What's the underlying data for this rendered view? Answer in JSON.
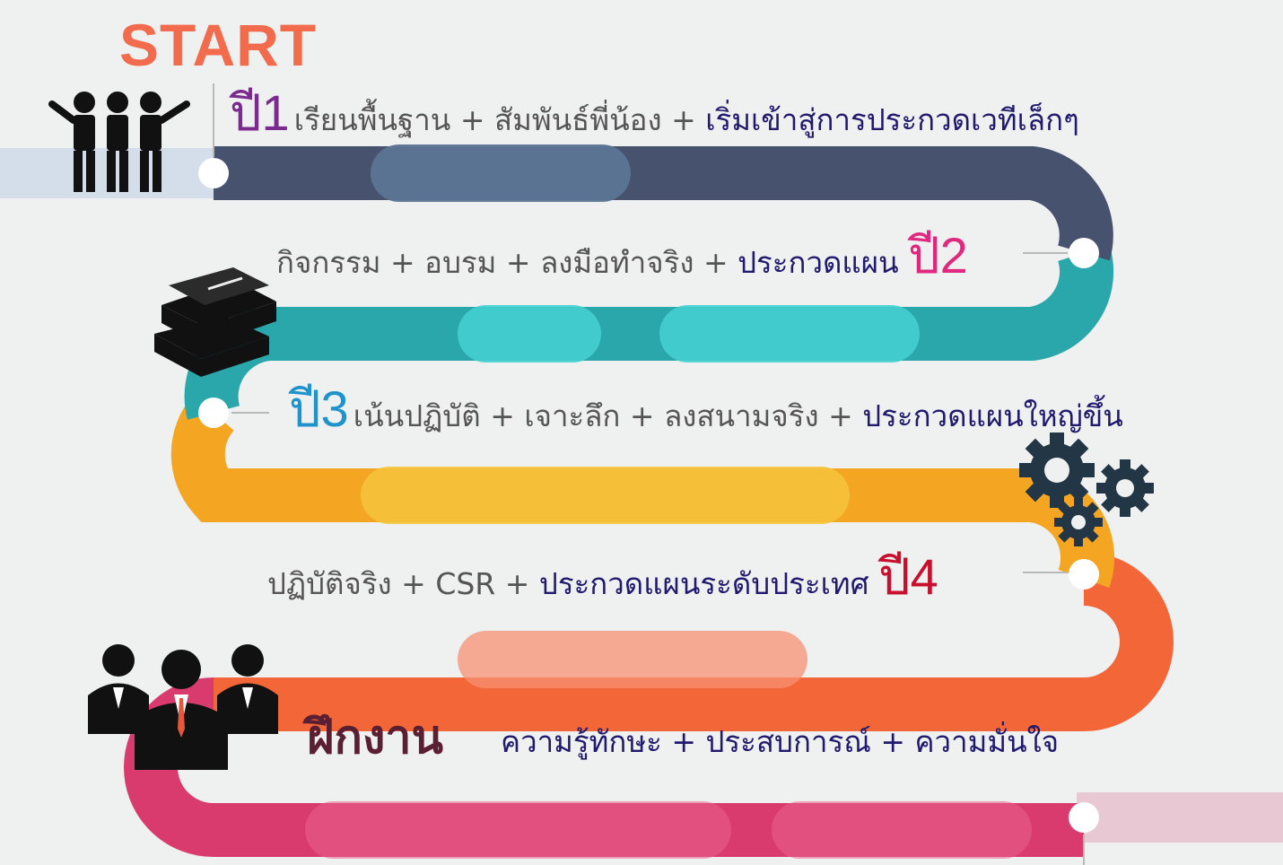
{
  "start_label": "START",
  "milestones": [
    {
      "year_label": "ปี1",
      "year_color": "#7b2a8f",
      "items": [
        "เรียนพื้นฐาน",
        "สัมพันธ์พี่น้อง"
      ],
      "highlight": "เริ่มเข้าสู่การประกวดเวทีเล็กๆ"
    },
    {
      "year_label": "ปี2",
      "year_color": "#e0297e",
      "items": [
        "กิจกรรม",
        "อบรม",
        "ลงมือทำจริง"
      ],
      "highlight": "ประกวดแผน"
    },
    {
      "year_label": "ปี3",
      "year_color": "#1f93cc",
      "items": [
        "เน้นปฏิบัติ",
        "เจาะลึก",
        "ลงสนามจริง"
      ],
      "highlight": "ประกวดแผนใหญ่ขึ้น"
    },
    {
      "year_label": "ปี4",
      "year_color": "#c8102e",
      "items": [
        "ปฏิบัติจริง",
        "CSR"
      ],
      "highlight": "ประกวดแผนระดับประเทศ"
    },
    {
      "title": "ฝึกงาน",
      "items": [
        "ความรู้ทักษะ",
        "ประสบการณ์",
        "ความมั่นใจ"
      ]
    }
  ],
  "separator": "+",
  "road_colors": [
    "#47526f",
    "#2aa7ab",
    "#f4a522",
    "#f26637",
    "#d93b6e"
  ],
  "icons": [
    "team-icon",
    "books-icon",
    "gears-icon",
    "business-team-icon"
  ]
}
